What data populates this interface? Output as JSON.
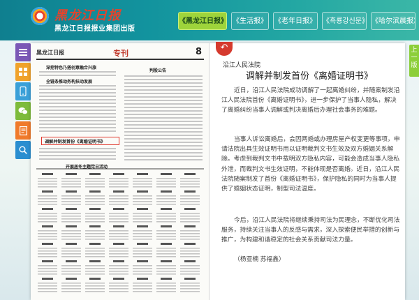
{
  "header": {
    "brand_title": "黑龙江日报",
    "brand_subtitle": "黑龙江日报报业集团出版",
    "tabs": [
      {
        "label": "《黑龙江日报》",
        "active": true
      },
      {
        "label": "《生活报》",
        "active": false
      },
      {
        "label": "《老年日报》",
        "active": false
      },
      {
        "label": "《흑룡강신문》",
        "active": false
      },
      {
        "label": "《哈尔滨晨报》",
        "active": false
      }
    ]
  },
  "toolbar": {
    "items": [
      {
        "icon": "menu-icon",
        "color": "#7b58b6"
      },
      {
        "icon": "grid-icon",
        "color": "#f0a22b"
      },
      {
        "icon": "phone-icon",
        "color": "#3aa0d8"
      },
      {
        "icon": "wechat-icon",
        "color": "#7dbb3b"
      },
      {
        "icon": "document-icon",
        "color": "#f07a2b"
      },
      {
        "icon": "search-icon",
        "color": "#2a8ed0"
      }
    ]
  },
  "newspaper": {
    "masthead": "黑龙江日报",
    "section": "专刊",
    "page_number": "8",
    "headlines": [
      "深挖特色乃搭创意融合兴旅",
      "全链条推动务构扶动发展",
      "调解并制发首份《离婚证明书》",
      "开展居冬主题党日活动",
      "判股公告"
    ]
  },
  "article": {
    "kicker": "沿江人民法院",
    "headline": "调解并制发首份《离婚证明书》",
    "paragraphs": [
      "近日，沿江人民法院成功调解了一起离婚纠纷，并随案制发沿江人民法院首份《离婚证明书》，进一步保护了当事人隐私，解决了离婚纠纷当事人调解或判决离婚后办理社会事务的难题。",
      "当事人诉讼离婚后，会因两婚或办理房屋产权变更等事项，申请法院出具生效证明书用以证明裁判文书生效及双方婚姻关系解除。考虑到裁判文书中载明双方隐私内容，可能会造成当事人隐私外泄，而裁判文书生效证明，不能体现是否离婚。近日，沿江人民法院随案制发了首份《离婚证明书》，保护隐私的同时为当事人提供了婚姻状态证明，制型司法温度。",
      "今后，沿江人民法院将继续秉持司法为民理念，不断优化司法服务，持续关注当事人的反感与需求，深入探索便民举措的创新与推广，为构建和谐稳定的社会关系贡献司法力量。",
      "（杨亚楠 苏福鑫）"
    ]
  },
  "next_button": {
    "label": "上一版"
  },
  "colors": {
    "header_start": "#0f7f8f",
    "header_end": "#3bb7a7",
    "active_tab": "#9ed43b",
    "accent_red": "#d53a2e",
    "next_green": "#8ccf3a"
  }
}
